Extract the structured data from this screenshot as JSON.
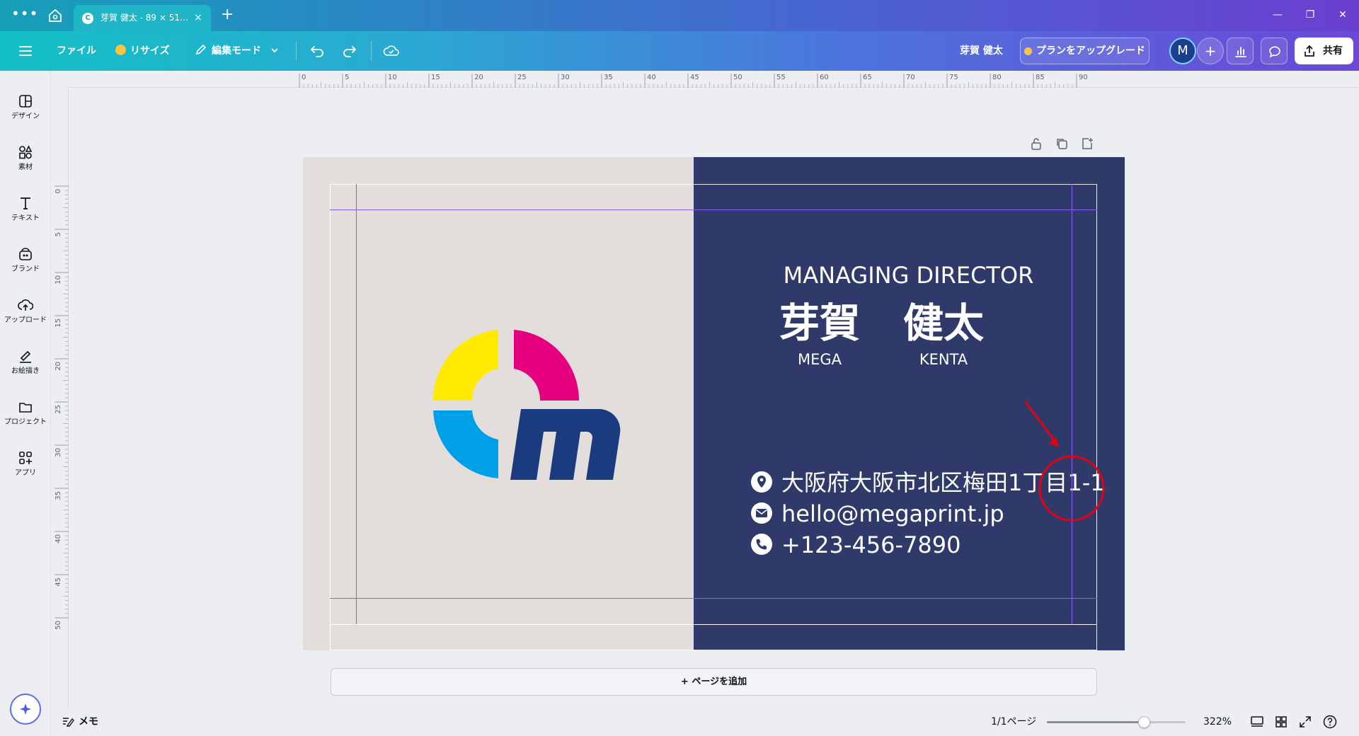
{
  "window": {
    "tab_title": "芽賀 健太 - 89 × 51…",
    "tab_close": "×",
    "new_tab": "+",
    "minimize": "—",
    "restore": "❐",
    "close": "✕"
  },
  "toolbar": {
    "file": "ファイル",
    "resize": "リサイズ",
    "edit_mode": "編集モード",
    "owner_name": "芽賀 健太",
    "upgrade": "プランをアップグレード",
    "avatar_initial": "M",
    "add_member": "+",
    "share": "共有"
  },
  "sidebar": {
    "items": [
      {
        "label": "デザイン",
        "icon": "design-icon"
      },
      {
        "label": "素材",
        "icon": "elements-icon"
      },
      {
        "label": "テキスト",
        "icon": "text-icon"
      },
      {
        "label": "ブランド",
        "icon": "brand-icon"
      },
      {
        "label": "アップロード",
        "icon": "upload-icon"
      },
      {
        "label": "お絵描き",
        "icon": "draw-icon"
      },
      {
        "label": "プロジェクト",
        "icon": "folder-icon"
      },
      {
        "label": "アプリ",
        "icon": "apps-icon"
      }
    ]
  },
  "ruler": {
    "h_ticks": [
      "0",
      "5",
      "10",
      "15",
      "20",
      "25",
      "30",
      "35",
      "40",
      "45",
      "50",
      "55",
      "60",
      "65",
      "70",
      "75",
      "80",
      "85",
      "90"
    ],
    "v_ticks": [
      "0",
      "5",
      "10",
      "15",
      "20",
      "25",
      "30",
      "35",
      "40",
      "45",
      "50"
    ]
  },
  "card": {
    "position_title": "MANAGING DIRECTOR",
    "surname_jp": "芽賀",
    "given_jp": "健太",
    "surname_en": "MEGA",
    "given_en": "KENTA",
    "address": "大阪府大阪市北区梅田1丁目1-1",
    "email": "hello@megaprint.jp",
    "phone": "+123-456-7890",
    "colors": {
      "light_panel": "#e3dedb",
      "dark_panel": "#2f3a6a",
      "logo_yellow": "#ffea00",
      "logo_magenta": "#e4007f",
      "logo_cyan": "#00a0e9",
      "logo_navy": "#1b3b7f",
      "annotation_red": "#e60012",
      "guide_purple": "#8b5cf6"
    }
  },
  "add_page": "+ ページを追加",
  "bottom": {
    "notes": "メモ",
    "page_indicator": "1/1ページ",
    "zoom": "322%",
    "zoom_level": 0.7
  }
}
